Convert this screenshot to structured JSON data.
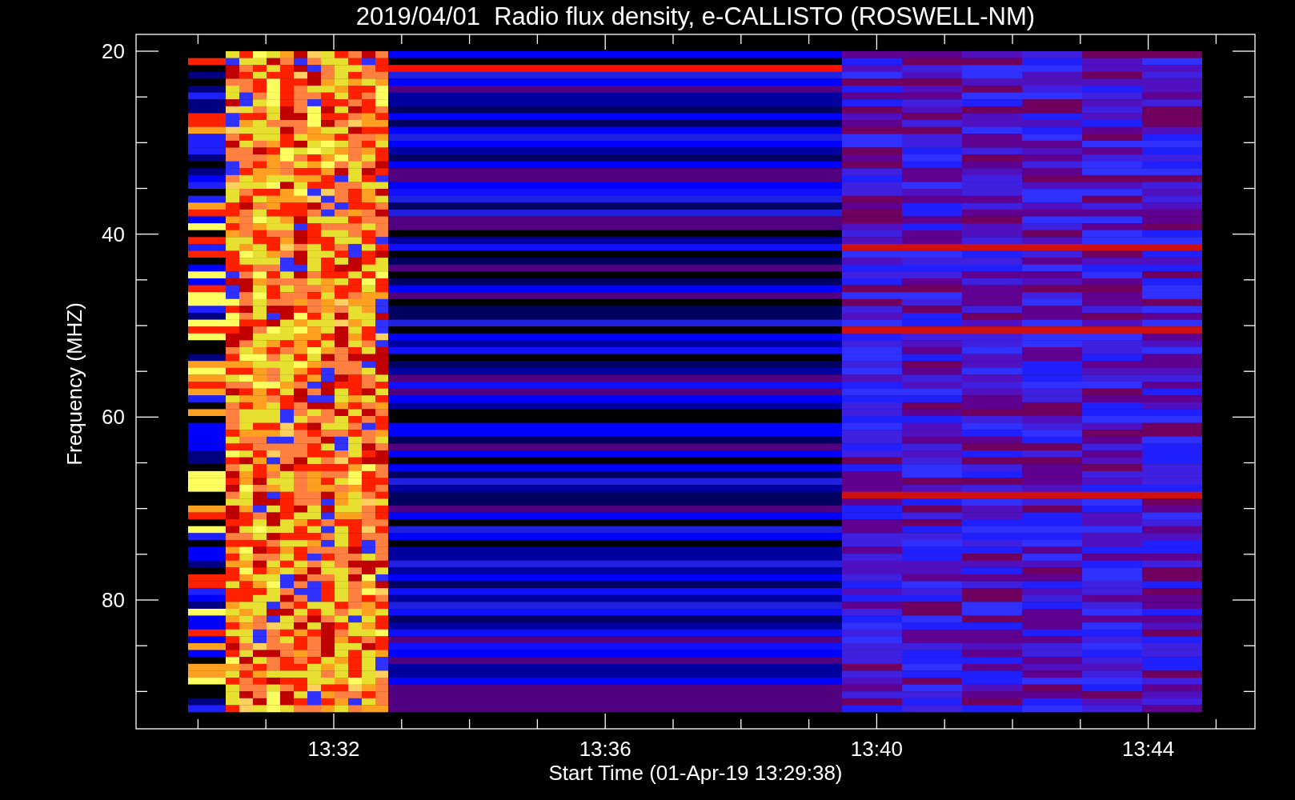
{
  "plot": {
    "title": "2019/04/01  Radio flux density, e-CALLISTO (ROSWELL-NM)",
    "y_axis": {
      "label": "Frequency (MHZ)",
      "ticks": [
        "20",
        "40",
        "60",
        "80"
      ]
    },
    "x_axis": {
      "label": "Start Time (01-Apr-19 13:29:38)",
      "ticks": [
        "13:32",
        "13:36",
        "13:40",
        "13:44"
      ]
    }
  }
}
